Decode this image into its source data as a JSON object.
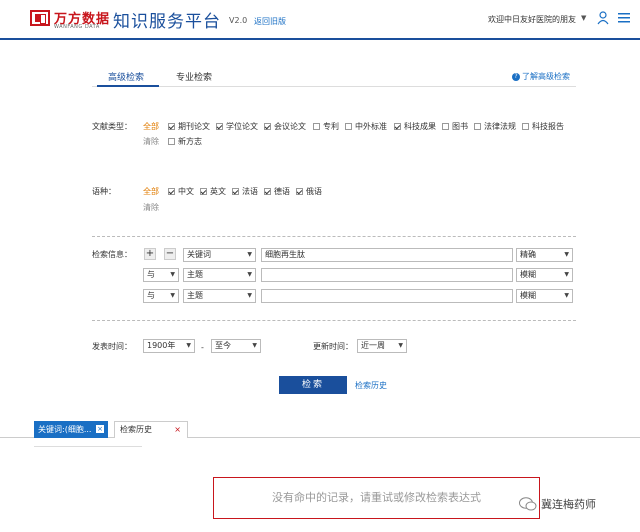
{
  "header": {
    "logo_cn": "万方数据",
    "logo_en": "WANFANG DATA",
    "app_title": "知识服务平台",
    "version": "V2.0",
    "old_version_link": "返回旧版",
    "welcome": "欢迎中日友好医院的朋友",
    "brand_color": "#1a4f9c"
  },
  "tabs": {
    "advanced": "高级检索",
    "professional": "专业检索",
    "help": "了解高级检索"
  },
  "doc_type": {
    "label": "文献类型：",
    "all": "全部",
    "clear": "清除",
    "options": [
      {
        "label": "期刊论文",
        "checked": true
      },
      {
        "label": "学位论文",
        "checked": true
      },
      {
        "label": "会议论文",
        "checked": true
      },
      {
        "label": "专利",
        "checked": false
      },
      {
        "label": "中外标准",
        "checked": false
      },
      {
        "label": "科技成果",
        "checked": true
      },
      {
        "label": "图书",
        "checked": false
      },
      {
        "label": "法律法规",
        "checked": false
      },
      {
        "label": "科技报告",
        "checked": false
      },
      {
        "label": "新方志",
        "checked": false
      }
    ]
  },
  "language": {
    "label": "语种：",
    "all": "全部",
    "clear": "清除",
    "options": [
      {
        "label": "中文",
        "checked": true
      },
      {
        "label": "英文",
        "checked": true
      },
      {
        "label": "法语",
        "checked": true
      },
      {
        "label": "德语",
        "checked": true
      },
      {
        "label": "俄语",
        "checked": true
      }
    ]
  },
  "search_info": {
    "label": "检索信息：",
    "add": "+",
    "remove": "−",
    "rows": [
      {
        "logic": "",
        "field": "关键词",
        "value": "细胞再生肽",
        "match": "精确"
      },
      {
        "logic": "与",
        "field": "主题",
        "value": "",
        "match": "模糊"
      },
      {
        "logic": "与",
        "field": "主题",
        "value": "",
        "match": "模糊"
      }
    ]
  },
  "time": {
    "label": "发表时间：",
    "from": "1900年",
    "sep": "-",
    "to": "至今",
    "update_label": "更新时间：",
    "update_value": "近一周"
  },
  "actions": {
    "search": "检索",
    "history": "检索历史"
  },
  "result_tabs": [
    {
      "label": "关键词:(细胞...",
      "close": "×"
    },
    {
      "label": "检索历史",
      "close": "×"
    }
  ],
  "no_result": "没有命中的记录，请重试或修改检索表达式",
  "watermark": "冀连梅药师"
}
